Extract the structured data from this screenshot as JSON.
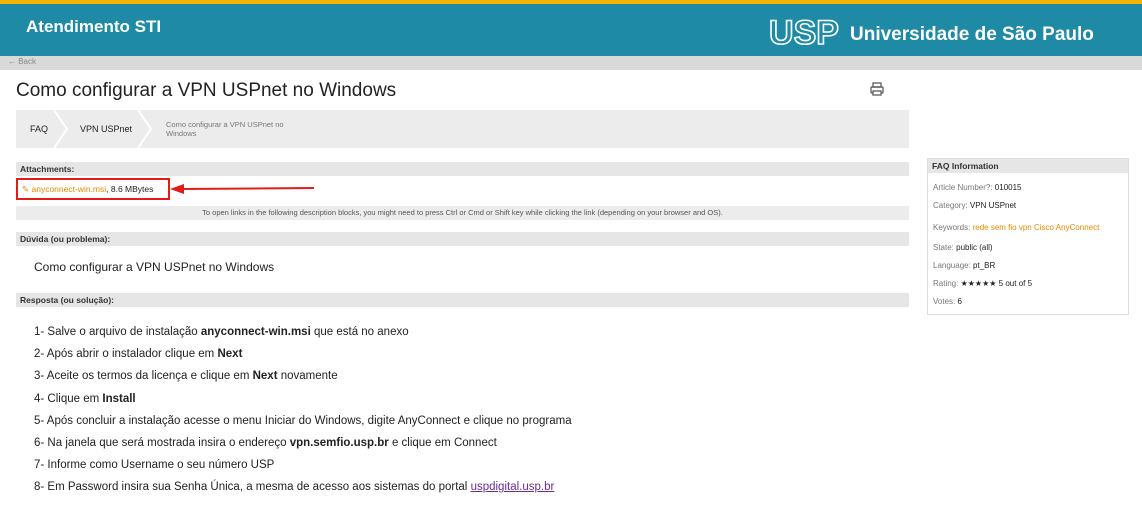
{
  "header": {
    "app_title": "Atendimento STI",
    "logo_text": "USP",
    "university": "Universidade de São Paulo",
    "color": "#1e8aa6",
    "accent": "#f5b400"
  },
  "nav": {
    "back": "← Back"
  },
  "page": {
    "title": "Como configurar a VPN USPnet no Windows",
    "print_icon": "print-icon"
  },
  "breadcrumb": [
    "FAQ",
    "VPN USPnet",
    "Como configurar a VPN USPnet no Windows"
  ],
  "attachments": {
    "header": "Attachments:",
    "file_name": "anyconnect-win.msi",
    "file_size": ", 8.6 MBytes",
    "notice": "To open links in the following description blocks, you might need to press Ctrl or Cmd or Shift key while clicking the link (depending on your browser and OS)."
  },
  "question": {
    "header": "Dúvida (ou problema):",
    "text": "Como configurar a VPN USPnet no Windows"
  },
  "answer": {
    "header": "Resposta (ou solução):",
    "steps": [
      {
        "pre": "1- Salve o arquivo de instalação ",
        "bold": "anyconnect-win.msi",
        "post": " que está no anexo"
      },
      {
        "pre": "2- Após abrir o instalador clique em ",
        "bold": "Next",
        "post": ""
      },
      {
        "pre": "3- Aceite os termos da licença e clique em ",
        "bold": "Next",
        "post": " novamente"
      },
      {
        "pre": "4- Clique em ",
        "bold": "Install",
        "post": ""
      },
      {
        "pre": "5- Após concluir a instalação acesse o menu Iniciar do Windows, digite AnyConnect e clique no programa",
        "bold": "",
        "post": ""
      },
      {
        "pre": "6- Na janela que será mostrada insira o endereço ",
        "bold": "vpn.semfio.usp.br",
        "post": " e clique em Connect"
      },
      {
        "pre": "7- Informe como Username o seu número USP",
        "bold": "",
        "post": ""
      },
      {
        "pre": "8- Em Password insira sua Senha Única, a mesma de acesso aos sistemas do portal ",
        "bold": "",
        "post": "",
        "link": "uspdigital.usp.br"
      }
    ]
  },
  "faq_info": {
    "header": "FAQ Information",
    "article_label": "Article Number?: ",
    "article_value": "010015",
    "category_label": "Category: ",
    "category_value": "VPN USPnet",
    "keywords_label": "Keywords: ",
    "keywords_value": "rede sem fio vpn Cisco AnyConnect",
    "state_label": "State: ",
    "state_value": "public (all)",
    "language_label": "Language: ",
    "language_value": "pt_BR",
    "rating_label": "Rating: ",
    "rating_stars": "★★★★★",
    "rating_value": "5 out of 5",
    "rating": 5,
    "votes_label": "Votes: ",
    "votes_value": "6"
  }
}
